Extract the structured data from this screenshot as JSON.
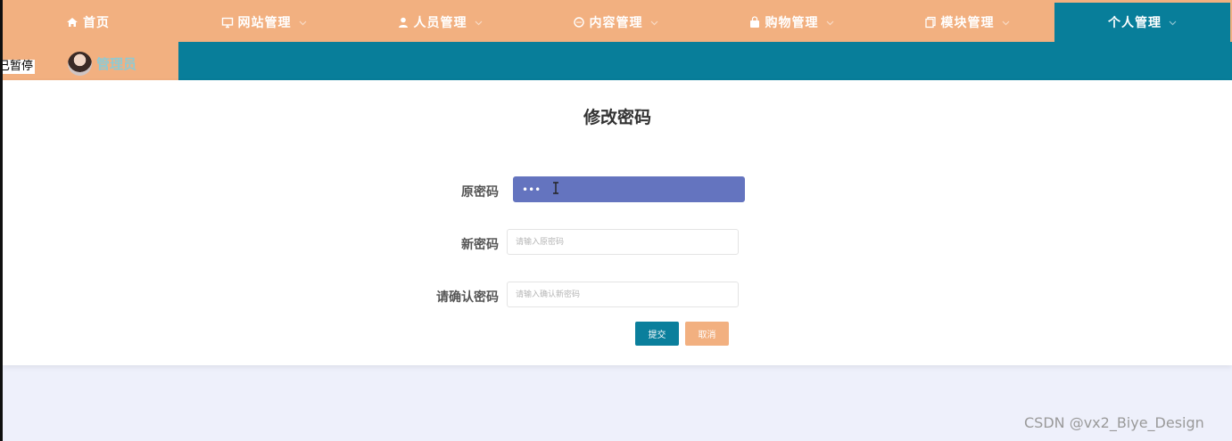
{
  "nav": {
    "items": [
      {
        "label": "首页",
        "icon": "home-icon",
        "has_dropdown": false
      },
      {
        "label": "网站管理",
        "icon": "monitor-icon",
        "has_dropdown": true
      },
      {
        "label": "人员管理",
        "icon": "user-icon",
        "has_dropdown": true
      },
      {
        "label": "内容管理",
        "icon": "chat-icon",
        "has_dropdown": true
      },
      {
        "label": "购物管理",
        "icon": "bag-icon",
        "has_dropdown": true
      },
      {
        "label": "模块管理",
        "icon": "copy-icon",
        "has_dropdown": true
      },
      {
        "label": "个人管理",
        "icon": "",
        "has_dropdown": true,
        "active": true
      }
    ],
    "colors": {
      "bar": "#f2b080",
      "active": "#087e9a"
    }
  },
  "subbar": {
    "overlay_text": "已暂停",
    "admin_name": "管理员"
  },
  "form": {
    "title": "修改密码",
    "old_password_label": "原密码",
    "old_password_value": "•••",
    "new_password_label": "新密码",
    "new_password_placeholder": "请输入原密码",
    "confirm_label": "请确认密码",
    "confirm_placeholder": "请输入确认新密码",
    "submit_label": "提交",
    "cancel_label": "取消"
  },
  "watermark": "CSDN @vx2_Biye_Design"
}
